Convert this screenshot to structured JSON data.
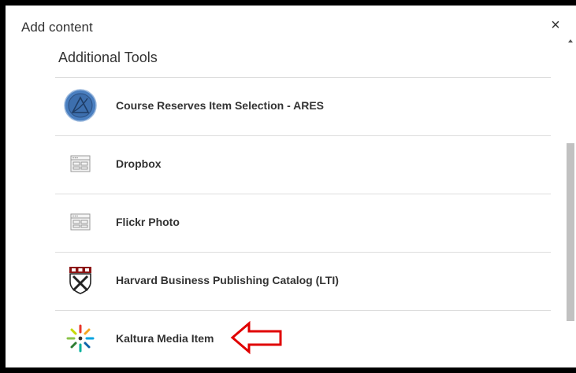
{
  "dialog": {
    "title": "Add content",
    "close_label": "×"
  },
  "section": {
    "title": "Additional Tools"
  },
  "tools": [
    {
      "label": "Course Reserves Item Selection - ARES",
      "icon": "ares-logo-icon"
    },
    {
      "label": "Dropbox",
      "icon": "app-window-icon"
    },
    {
      "label": "Flickr Photo",
      "icon": "app-window-icon"
    },
    {
      "label": "Harvard Business Publishing Catalog (LTI)",
      "icon": "harvard-shield-icon"
    },
    {
      "label": "Kaltura Media Item",
      "icon": "kaltura-logo-icon"
    }
  ],
  "colors": {
    "ares_blue": "#4a7fc0",
    "harvard_crimson": "#8c1515",
    "annotation_red": "#e00000"
  }
}
